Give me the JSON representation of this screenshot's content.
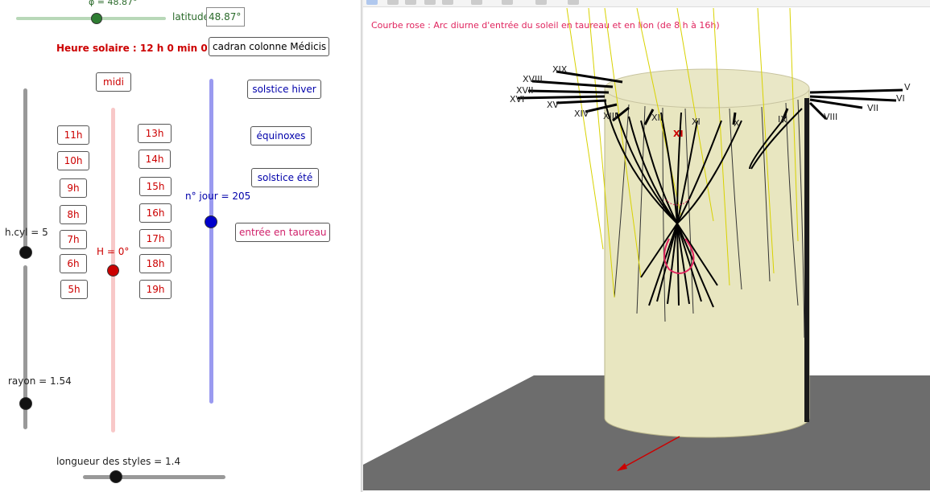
{
  "controls": {
    "phi_label": "φ = 48.87°",
    "latitude_label": "latitude",
    "latitude_value": "48.87°",
    "heure_solaire": "Heure solaire : 12 h 0 min 0 s",
    "cadran_button": "cadran colonne Médicis",
    "midi_button": "midi",
    "hours_left": [
      "11h",
      "10h",
      "9h",
      "8h",
      "7h",
      "6h",
      "5h"
    ],
    "hours_right": [
      "13h",
      "14h",
      "15h",
      "16h",
      "17h",
      "18h",
      "19h"
    ],
    "H_label": "H = 0°",
    "n_jour_label": "n° jour = 205",
    "solstice_hiver": "solstice hiver",
    "equinoxes": "équinoxes",
    "solstice_ete": "solstice été",
    "entree_taureau": "entrée en taureau",
    "hcyl_label": "h.cyl = 5",
    "rayon_label": "rayon = 1.54",
    "longueur_label": "longueur des styles = 1.4"
  },
  "view3d": {
    "caption": "Courbe rose : Arc diurne d'entrée du soleil en taureau et en lion (de 8 h à 16h)",
    "roman_left": [
      "XIX",
      "XVIII",
      "XVII",
      "XVI",
      "XV",
      "XIV",
      "XIII",
      "XII"
    ],
    "roman_center": "XI",
    "roman_right": [
      "XI",
      "X",
      "IX",
      "VIII",
      "VII",
      "VI",
      "V"
    ]
  },
  "colors": {
    "cylinder": "#e8e6c0",
    "floor": "#6d6d6d",
    "pink": "#e0245e",
    "red": "#cc0000",
    "blue": "#0000aa"
  }
}
